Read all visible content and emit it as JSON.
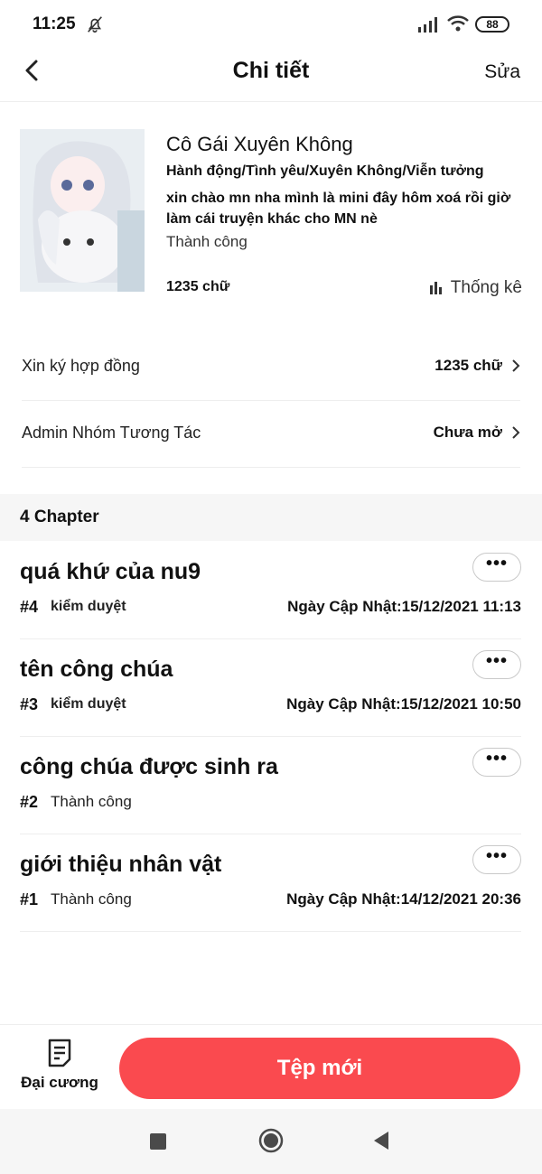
{
  "status_bar": {
    "time": "11:25",
    "battery": "88"
  },
  "header": {
    "title": "Chi tiết",
    "edit_label": "Sửa"
  },
  "book": {
    "title": "Cô Gái Xuyên Không",
    "genres": "Hành động/Tình yêu/Xuyên Không/Viễn tưởng",
    "description": "xin chào mn nha mình là mini đây hôm xoá rồi giờ làm cái truyện khác cho MN nè",
    "status": "Thành công",
    "word_count": "1235 chữ",
    "stats_label": "Thống kê"
  },
  "rows": [
    {
      "label": "Xin ký hợp đồng",
      "value": "1235 chữ"
    },
    {
      "label": "Admin Nhóm Tương Tác",
      "value": "Chưa mở"
    }
  ],
  "chapters_section": {
    "label": "4 Chapter"
  },
  "chapters": [
    {
      "title": "quá khứ của nu9",
      "number": "#4",
      "status": "kiểm duyệt",
      "date": "Ngày Cập Nhật:15/12/2021 11:13"
    },
    {
      "title": "tên công chúa",
      "number": "#3",
      "status": "kiểm duyệt",
      "date": "Ngày Cập Nhật:15/12/2021 10:50"
    },
    {
      "title": "công chúa được sinh ra",
      "number": "#2",
      "status": "Thành công",
      "date": ""
    },
    {
      "title": "giới thiệu nhân vật",
      "number": "#1",
      "status": "Thành công",
      "date": "Ngày Cập Nhật:14/12/2021 20:36"
    }
  ],
  "more_label": "•••",
  "bottom": {
    "outline_label": "Đại cương",
    "new_button_label": "Tệp mới"
  },
  "colors": {
    "accent": "#fa4a4f"
  }
}
